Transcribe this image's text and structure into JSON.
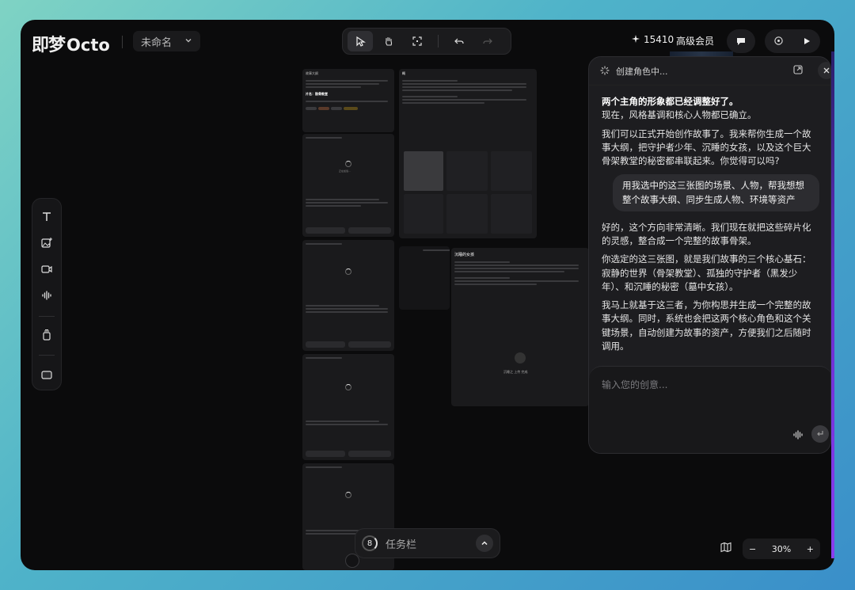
{
  "app": {
    "logo_cn": "即梦",
    "logo_en": "Octo",
    "project_name": "未命名"
  },
  "header": {
    "credits": "15410",
    "member_label": "高级会员"
  },
  "canvas": {
    "card_main_title": "故事大纲",
    "card_main_subtitle": "片名：骸骨教堂",
    "card_world_title": "概",
    "card_girl_title": "沉睡的女孩",
    "card_girl_caption": "沉睡之 上传 完成",
    "loading_text": "正在加载..."
  },
  "taskbar": {
    "count": "8",
    "label": "任务栏"
  },
  "zoom": {
    "minus": "−",
    "value": "30%",
    "plus": "+"
  },
  "chat": {
    "title": "创建角色中...",
    "msg1_bold": "两个主角的形象都已经调整好了。",
    "msg1_text": "现在，风格基调和核心人物都已确立。",
    "msg2": "我们可以正式开始创作故事了。我来帮你生成一个故事大纲，把守护者少年、沉睡的女孩，以及这个巨大骨架教堂的秘密都串联起来。你觉得可以吗?",
    "user_msg": "用我选中的这三张图的场景、人物，帮我想想整个故事大纲、同步生成人物、环境等资产",
    "msg3": "好的，这个方向非常清晰。我们现在就把这些碎片化的灵感，整合成一个完整的故事骨架。",
    "msg4": "你选定的这三张图，就是我们故事的三个核心基石：寂静的世界（骨架教堂）、孤独的守护者（黑发少年）、和沉睡的秘密（墓中女孩）。",
    "msg5": "我马上就基于这三者，为你构思并生成一个完整的故事大纲。同时，系统也会把这两个核心角色和这个关键场景，自动创建为故事的资产，方便我们之后随时调用。",
    "input_placeholder": "输入您的创意..."
  }
}
